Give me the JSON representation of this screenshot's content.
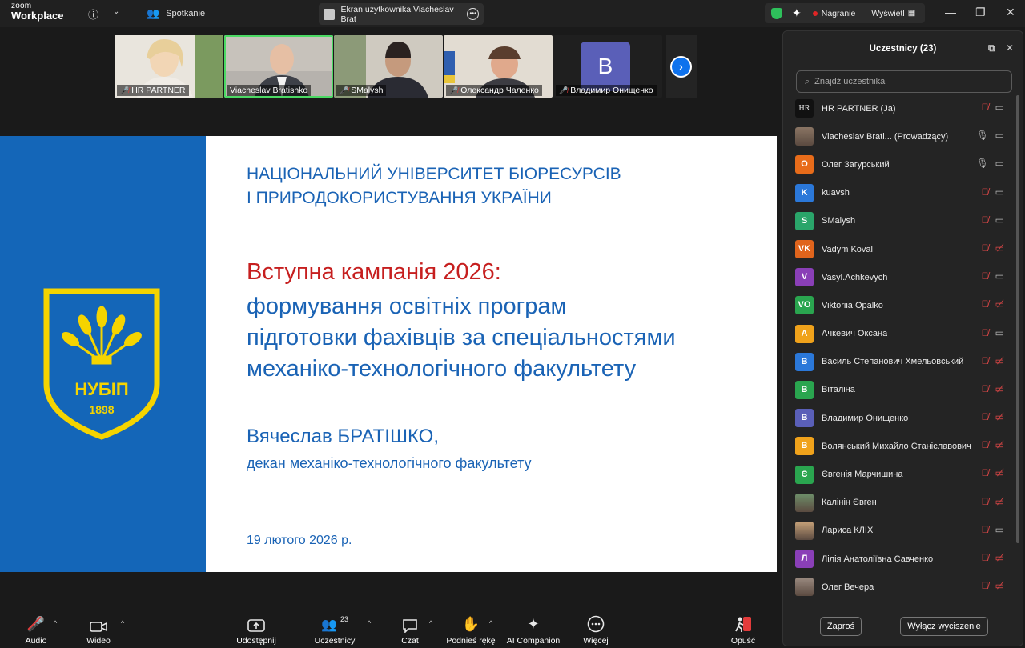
{
  "app": {
    "logo_top": "zoom",
    "logo_bottom": "Workplace"
  },
  "titlebar": {
    "meeting_label": "Spotkanie",
    "share_tab_label": "Ekran użytkownika Viacheslav Brat",
    "recording_label": "Nagranie",
    "view_label": "Wyświetl"
  },
  "thumbnails": [
    {
      "name": "HR PARTNER",
      "muted": true
    },
    {
      "name": "Viacheslav Bratishko",
      "muted": false,
      "active": true
    },
    {
      "name": "SMalysh",
      "muted": true
    },
    {
      "name": "Олександр Чаленко",
      "muted": true
    },
    {
      "name": "Владимир Онищенко",
      "muted": true,
      "initial": "B"
    }
  ],
  "slide": {
    "university_line1": "НАЦІОНАЛЬНИЙ УНІВЕРСИТЕТ БІОРЕСУРСІВ",
    "university_line2": "І ПРИРОДОКОРИСТУВАННЯ УКРАЇНИ",
    "title_red": "Вступна кампанія 2026:",
    "title_line2": "формування освітніх програм",
    "title_line3": "підготовки фахівців за спеціальностями",
    "title_line4": "механіко-технологічного факультету",
    "author": "Вячеслав БРАТІШКО,",
    "role": "декан механіко-технологічного факультету",
    "date": "19 лютого 2026 р.",
    "emblem_text": "НУБІП",
    "emblem_year": "1898"
  },
  "toolbar": {
    "audio": "Audio",
    "video": "Wideo",
    "share": "Udostępnij",
    "participants": "Uczestnicy",
    "participants_count": "23",
    "chat": "Czat",
    "raise_hand": "Podnieś rękę",
    "ai_companion": "AI Companion",
    "more": "Więcej",
    "leave": "Opuść"
  },
  "panel": {
    "title": "Uczestnicy (23)",
    "search_placeholder": "Znajdź uczestnika",
    "invite_label": "Zaproś",
    "mute_label": "Wyłącz wyciszenie",
    "participants": [
      {
        "name": "HR PARTNER (Ja)",
        "avatar": "HR",
        "color": "#111111",
        "mic": "off",
        "cam": "on"
      },
      {
        "name": "Viacheslav Brati... (Prowadzący)",
        "avatar": "photo",
        "color": "#8a7564",
        "mic": "on",
        "cam": "on"
      },
      {
        "name": "Олег Загурський",
        "avatar": "О",
        "color": "#e86c1a",
        "mic": "on",
        "cam": "on"
      },
      {
        "name": "kuavsh",
        "avatar": "K",
        "color": "#2b78d9",
        "mic": "off",
        "cam": "on"
      },
      {
        "name": "SMalysh",
        "avatar": "S",
        "color": "#2aa56a",
        "mic": "off",
        "cam": "on"
      },
      {
        "name": "Vadym Koval",
        "avatar": "VK",
        "color": "#e0641c",
        "mic": "off",
        "cam": "off"
      },
      {
        "name": "Vasyl.Achkevych",
        "avatar": "V",
        "color": "#8a3fb7",
        "mic": "off",
        "cam": "on"
      },
      {
        "name": "Viktoriia Opalko",
        "avatar": "VO",
        "color": "#2aa54f",
        "mic": "off",
        "cam": "off"
      },
      {
        "name": "Ачкевич Оксана",
        "avatar": "A",
        "color": "#f0a21b",
        "mic": "off",
        "cam": "on"
      },
      {
        "name": "Василь Степанович Хмельовський",
        "avatar": "B",
        "color": "#2b78d9",
        "mic": "off",
        "cam": "off"
      },
      {
        "name": "Віталіна",
        "avatar": "B",
        "color": "#2aa54f",
        "mic": "off",
        "cam": "off"
      },
      {
        "name": "Владимир Онищенко",
        "avatar": "B",
        "color": "#5a5fb8",
        "mic": "off",
        "cam": "off"
      },
      {
        "name": "Волянський Михайло Станіславович",
        "avatar": "B",
        "color": "#f0a21b",
        "mic": "off",
        "cam": "off"
      },
      {
        "name": "Євгенія Марчишина",
        "avatar": "Є",
        "color": "#2aa54f",
        "mic": "off",
        "cam": "off"
      },
      {
        "name": "Калінін Євген",
        "avatar": "photo",
        "color": "#6e8f6a",
        "mic": "off",
        "cam": "off"
      },
      {
        "name": "Лариса КЛІХ",
        "avatar": "photo",
        "color": "#c7a279",
        "mic": "off",
        "cam": "on"
      },
      {
        "name": "Лілія Анатоліївна Савченко",
        "avatar": "Л",
        "color": "#8a3fb7",
        "mic": "off",
        "cam": "off"
      },
      {
        "name": "Олег Вечера",
        "avatar": "photo",
        "color": "#9a8a80",
        "mic": "off",
        "cam": "off"
      }
    ]
  }
}
